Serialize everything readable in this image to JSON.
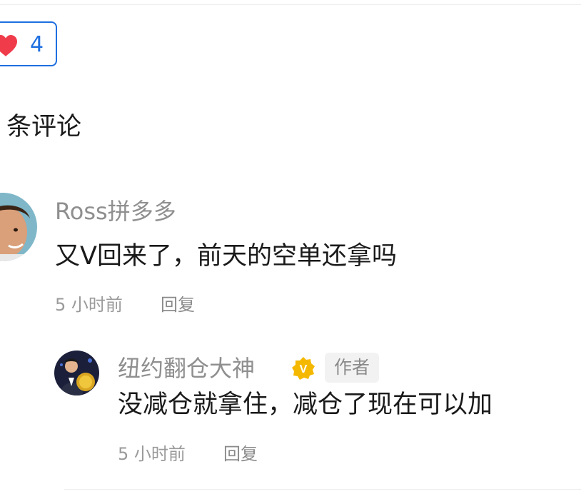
{
  "like": {
    "count": "4",
    "icon": "heart-icon",
    "heart_color": "#ef3b4a",
    "accent_color": "#1e6fe0"
  },
  "comments_section": {
    "heading": "条评论"
  },
  "comments": [
    {
      "username": "Ross拼多多",
      "avatar_icon": "user-avatar",
      "text": "又V回来了，前天的空单还拿吗",
      "time": "5 小时前",
      "reply_label": "回复",
      "replies": [
        {
          "username": "纽约翻仓大神",
          "verified_icon": "verified-badge-icon",
          "verified_color": "#f5b800",
          "verified_glyph": "V",
          "author_badge": "作者",
          "avatar_icon": "user-avatar",
          "text": "没减仓就拿住，减仓了现在可以加",
          "time": "5 小时前",
          "reply_label": "回复"
        }
      ]
    }
  ]
}
